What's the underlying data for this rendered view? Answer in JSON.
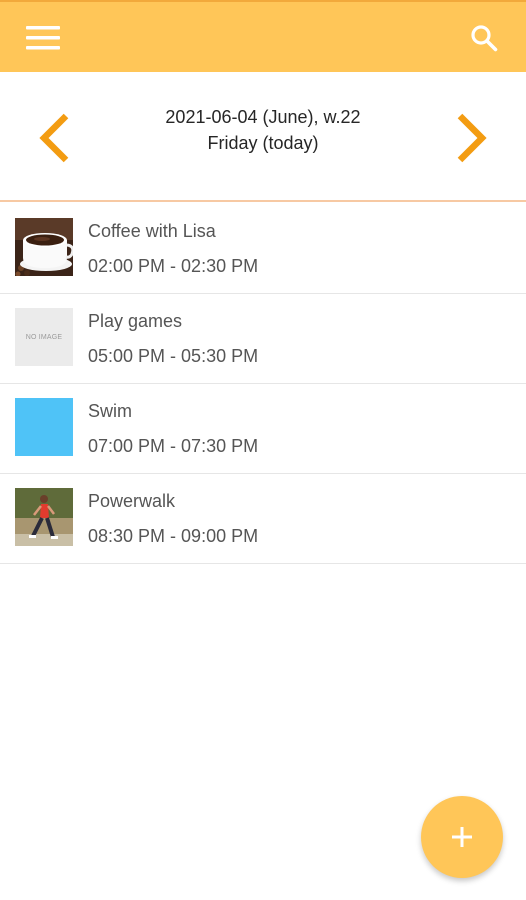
{
  "header": {
    "menu_icon": "hamburger-menu-icon",
    "search_icon": "search-icon",
    "background_color": "#ffc658"
  },
  "date_nav": {
    "date_line": "2021-06-04 (June), w.22",
    "day_line": "Friday (today)",
    "prev_icon": "chevron-left-icon",
    "next_icon": "chevron-right-icon",
    "arrow_color": "#f39c12"
  },
  "events": [
    {
      "title": "Coffee with Lisa",
      "time": "02:00 PM - 02:30 PM",
      "thumbnail": "coffee-cup-photo"
    },
    {
      "title": "Play games",
      "time": "05:00 PM - 05:30 PM",
      "thumbnail": "no-image-placeholder",
      "placeholder_text": "NO IMAGE"
    },
    {
      "title": "Swim",
      "time": "07:00 PM - 07:30 PM",
      "thumbnail": "blue-color-swatch",
      "thumbnail_color": "#4fc3f7"
    },
    {
      "title": "Powerwalk",
      "time": "08:30 PM - 09:00 PM",
      "thumbnail": "walker-photo"
    }
  ],
  "fab": {
    "icon": "plus-icon",
    "color": "#ffc658"
  }
}
